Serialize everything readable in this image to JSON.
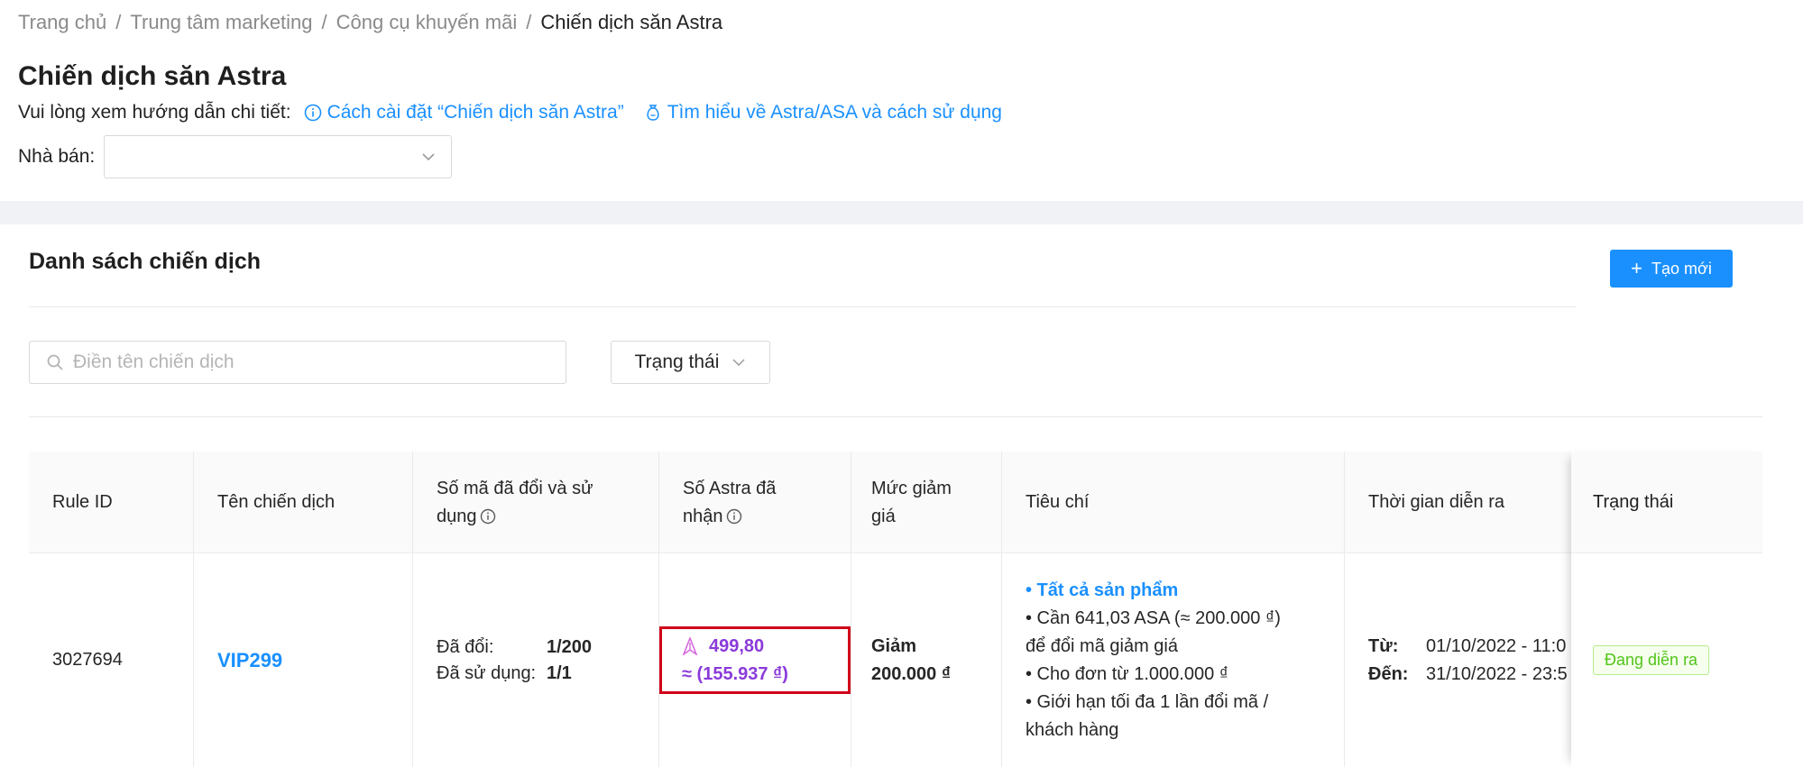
{
  "breadcrumb": {
    "items": [
      "Trang chủ",
      "Trung tâm marketing",
      "Công cụ khuyến mãi"
    ],
    "current": "Chiến dịch săn Astra",
    "separator": "/"
  },
  "page": {
    "title": "Chiến dịch săn Astra",
    "guide_label": "Vui lòng xem hướng dẫn chi tiết:",
    "guide_link_1": "Cách cài đặt “Chiến dịch săn Astra”",
    "guide_link_2": "Tìm hiểu về Astra/ASA và cách sử dụng",
    "seller_label": "Nhà bán",
    "seller_value": ""
  },
  "card": {
    "title": "Danh sách chiến dịch",
    "create_label": "Tạo mới",
    "search_placeholder": "Điền tên chiến dịch",
    "status_filter_label": "Trạng thái"
  },
  "table": {
    "columns": {
      "rule_id": "Rule ID",
      "name": "Tên chiến dịch",
      "codes": "Số mã đã đổi và sử dụng",
      "astra": "Số Astra đã nhận",
      "discount": "Mức giảm giá",
      "criteria": "Tiêu chí",
      "time": "Thời gian diễn ra",
      "status": "Trạng thái"
    },
    "rows": [
      {
        "rule_id": "3027694",
        "name": "VIP299",
        "exchanged_label": "Đã đổi:",
        "exchanged_value": "1/200",
        "used_label": "Đã sử dụng:",
        "used_value": "1/1",
        "astra_amount": "499,80",
        "astra_vnd": "≈ (155.937 ₫)",
        "discount_line1": "Giảm",
        "discount_line2": "200.000 ₫",
        "criteria_1": "• Tất cả sản phẩm",
        "criteria_2": "• Cần 641,03 ASA (≈ 200.000 ₫)",
        "criteria_3": "để đổi mã giảm giá",
        "criteria_4": "• Cho đơn từ 1.000.000 ₫",
        "criteria_5": "• Giới hạn tối đa 1 lần đổi mã /",
        "criteria_6": "khách hàng",
        "from_label": "Từ:",
        "from_value": "01/10/2022 - 11:0",
        "to_label": "Đến:",
        "to_value": "31/10/2022 - 23:5",
        "status": "Đang diễn ra"
      }
    ]
  },
  "colors": {
    "primary": "#1a90ff",
    "astra": "#8a3ad9",
    "highlight_border": "#d0021b",
    "status_green": "#52c41a"
  }
}
